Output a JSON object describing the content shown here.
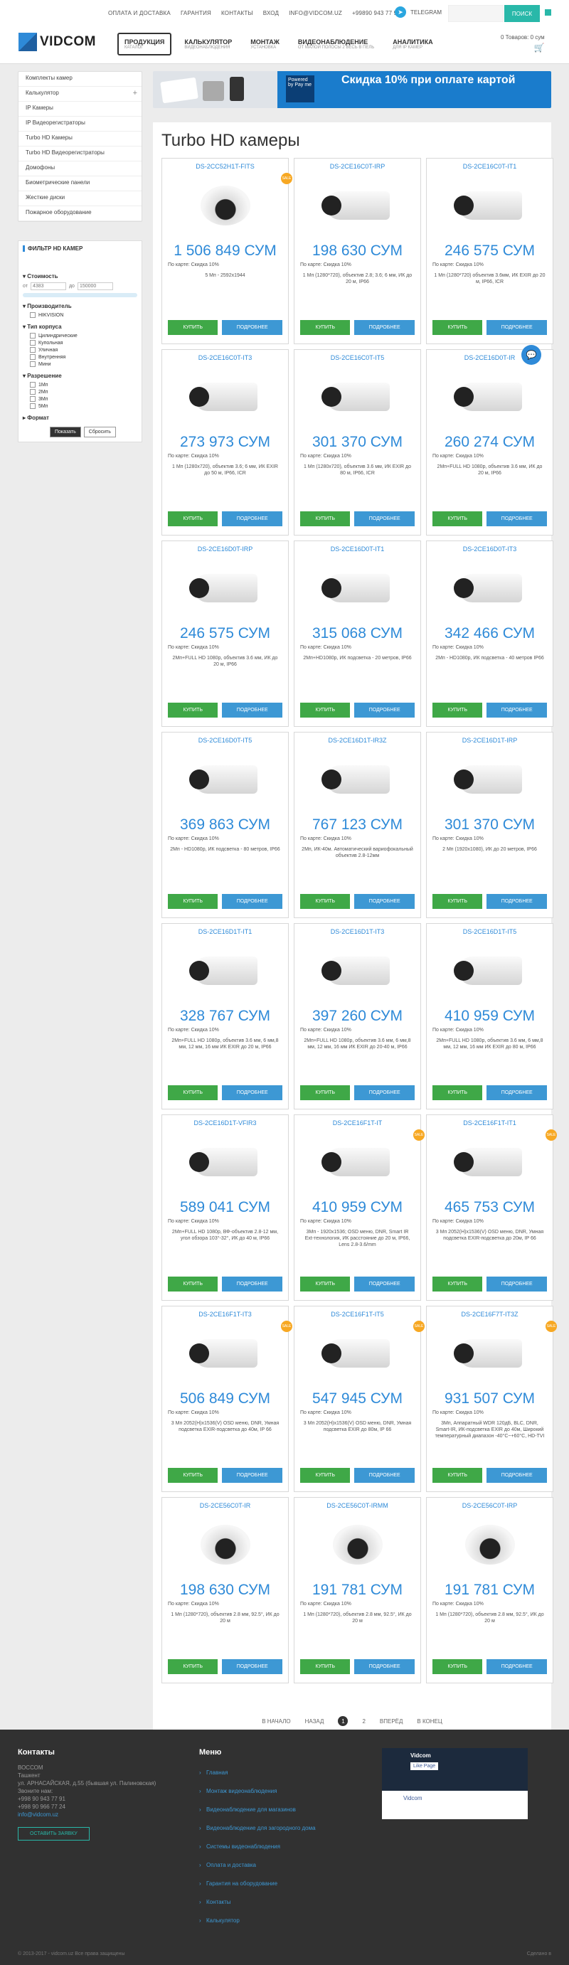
{
  "topbar": {
    "links": [
      "ОПЛАТА И ДОСТАВКА",
      "ГАРАНТИЯ",
      "КОНТАКТЫ",
      "ВХОД",
      "INFO@VIDCOM.UZ",
      "+99890 943 77 91"
    ],
    "telegram": "TELEGRAM",
    "search_button": "ПОИСК"
  },
  "header": {
    "logo": "VIDCOM",
    "nav": [
      {
        "title": "ПРОДУКЦИЯ",
        "sub": "КАТАЛОГ"
      },
      {
        "title": "КАЛЬКУЛЯТОР",
        "sub": "ВИДЕОНАБЛЮДЕНИЯ"
      },
      {
        "title": "МОНТАЖ",
        "sub": "УСТАНОВКА"
      },
      {
        "title": "ВИДЕОНАБЛЮДЕНИЕ",
        "sub": "ОТ МАЛОЙ ПОЛОСЫ 2 ВЕСЬ В ПЕЛЬ"
      },
      {
        "title": "АНАЛИТИКА",
        "sub": "ДЛЯ IP КАМЕР"
      }
    ],
    "cart": "0 Товаров: 0 сум"
  },
  "sidebar": {
    "categories": [
      "Комплекты камер",
      "Калькулятор",
      "IP Камеры",
      "IP Видеорегистраторы",
      "Turbo HD Камеры",
      "Turbo HD Видеорегистраторы",
      "Домофоны",
      "Биометрические панели",
      "Жесткие диски",
      "Пожарное оборудование"
    ],
    "filter": {
      "title": "ФИЛЬТР HD КАМЕР",
      "cost_label": "Стоимость",
      "from_label": "от",
      "from_value": "4383",
      "to_label": "до",
      "to_value": "150000",
      "maker_label": "Производитель",
      "makers": [
        "HIKVISION"
      ],
      "body_label": "Тип корпуса",
      "bodies": [
        "Цилиндрические",
        "Купольная",
        "Уличная",
        "Внутренняя",
        "Мини"
      ],
      "res_label": "Разрешение",
      "resolutions": [
        "1Мп",
        "2Мп",
        "3Мп",
        "5Мп"
      ],
      "format_label": "Формат",
      "show_button": "Показать",
      "reset_button": "Сбросить"
    }
  },
  "banner": {
    "powered": "Powered by Pay me",
    "text": "Скидка 10% при оплате картой"
  },
  "page_title": "Turbo HD камеры",
  "products": [
    {
      "code": "DS-2CC52H1T-FITS",
      "price": "1 506 849 СУМ",
      "card": "По карте:  Скидка 10%",
      "desc": "5 Мп - 2592х1944",
      "shape": "dome",
      "sale": true
    },
    {
      "code": "DS-2CE16C0T-IRP",
      "price": "198 630 СУМ",
      "card": "По карте:  Скидка 10%",
      "desc": "1 Мп (1280*720), объектив 2.8; 3.6; 6 мм, ИК до 20 м, IP66",
      "shape": "cam",
      "sale": false
    },
    {
      "code": "DS-2CE16C0T-IT1",
      "price": "246 575 СУМ",
      "card": "По карте:  Скидка 10%",
      "desc": "1 Мп (1280*720) объектив 3.6мм, ИК EXIR до 20 м, IP66, ICR",
      "shape": "cam",
      "sale": false
    },
    {
      "code": "DS-2CE16C0T-IT3",
      "price": "273 973 СУМ",
      "card": "По карте:  Скидка 10%",
      "desc": "1 Мп (1280x720), объектив 3.6; 6 мм, ИК EXIR до 50 м, IP66, ICR",
      "shape": "cam",
      "sale": false
    },
    {
      "code": "DS-2CE16C0T-IT5",
      "price": "301 370 СУМ",
      "card": "По карте:  Скидка 10%",
      "desc": "1 Мп (1280x720), объектив 3.6 мм, ИК EXIR до 80 м, IP66, ICR",
      "shape": "cam",
      "sale": false
    },
    {
      "code": "DS-2CE16D0T-IR",
      "price": "260 274 СУМ",
      "card": "По карте:  Скидка 10%",
      "desc": "2Мп+FULL HD 1080p, объектив 3.6 мм, ИК до 20 м, IP66",
      "shape": "cam",
      "sale": false
    },
    {
      "code": "DS-2CE16D0T-IRP",
      "price": "246 575 СУМ",
      "card": "По карте:  Скидка 10%",
      "desc": "2Мп+FULL HD 1080p, объектив 3.6 мм, ИК до 20 м, IP66",
      "shape": "cam",
      "sale": false
    },
    {
      "code": "DS-2CE16D0T-IT1",
      "price": "315 068 СУМ",
      "card": "По карте:  Скидка 10%",
      "desc": "2Мп+HD1080p, ИК подсветка - 20 метров, IP66",
      "shape": "cam",
      "sale": false
    },
    {
      "code": "DS-2CE16D0T-IT3",
      "price": "342 466 СУМ",
      "card": "По карте:  Скидка 10%",
      "desc": "2Мп - HD1080p, ИК подсветка - 40 метров IP66",
      "shape": "cam",
      "sale": false
    },
    {
      "code": "DS-2CE16D0T-IT5",
      "price": "369 863 СУМ",
      "card": "По карте:  Скидка 10%",
      "desc": "2Мп - HD1080p, ИК подсветка - 80 метров, IP66",
      "shape": "cam",
      "sale": false
    },
    {
      "code": "DS-2CE16D1T-IR3Z",
      "price": "767 123 СУМ",
      "card": "По карте:  Скидка 10%",
      "desc": "2Мп, ИК-40м. Автоматический вариофокальный объектив 2.8-12мм",
      "shape": "cam",
      "sale": false
    },
    {
      "code": "DS-2CE16D1T-IRP",
      "price": "301 370 СУМ",
      "card": "По карте:  Скидка 10%",
      "desc": "2 Мп (1920x1080), ИК до 20 метров, IP66",
      "shape": "cam",
      "sale": false
    },
    {
      "code": "DS-2CE16D1T-IT1",
      "price": "328 767 СУМ",
      "card": "По карте:  Скидка 10%",
      "desc": "2Мп+FULL HD 1080p, объектив 3.6 мм, 6 мм,8 мм, 12 мм, 16 мм ИК EXIR до 20 м, IP66",
      "shape": "cam",
      "sale": false
    },
    {
      "code": "DS-2CE16D1T-IT3",
      "price": "397 260 СУМ",
      "card": "По карте:  Скидка 10%",
      "desc": "2Мп+FULL HD 1080p, объектив 3.6 мм, 6 мм,8 мм, 12 мм, 16 мм ИК EXIR до 20-40 м, IP66",
      "shape": "cam",
      "sale": false
    },
    {
      "code": "DS-2CE16D1T-IT5",
      "price": "410 959 СУМ",
      "card": "По карте:  Скидка 10%",
      "desc": "2Мп+FULL HD 1080p, объектив 3.6 мм, 6 мм,8 мм, 12 мм, 16 мм ИК EXIR до 80 м, IP66",
      "shape": "cam",
      "sale": false
    },
    {
      "code": "DS-2CE16D1T-VFIR3",
      "price": "589 041 СУМ",
      "card": "По карте:  Скидка 10%",
      "desc": "2Мп+FULL HD 1080p, ВФ-объектив 2.8-12 мм, угол обзора 103°-32°, ИК до 40 м, IP66",
      "shape": "cam",
      "sale": false
    },
    {
      "code": "DS-2CE16F1T-IT",
      "price": "410 959 СУМ",
      "card": "По карте:  Скидка 10%",
      "desc": "3Мп - 1920x1536; OSD меню, DNR, Smart IR Ext-технология, ИК расстояние до 20 м, IP66, Lens 2.8-3.6/mm",
      "shape": "cam",
      "sale": true
    },
    {
      "code": "DS-2CE16F1T-IT1",
      "price": "465 753 СУМ",
      "card": "По карте:  Скидка 10%",
      "desc": "3 Мп 2052(H)x1536(V) OSD меню, DNR, Умная подсветка EXIR-подсветка до 20м, IP 66",
      "shape": "cam",
      "sale": true
    },
    {
      "code": "DS-2CE16F1T-IT3",
      "price": "506 849 СУМ",
      "card": "По карте:  Скидка 10%",
      "desc": "3 Мп 2052(H)x1536(V) OSD меню, DNR, Умная подсветка EXIR-подсветка до 40м, IP 66",
      "shape": "cam",
      "sale": true
    },
    {
      "code": "DS-2CE16F1T-IT5",
      "price": "547 945 СУМ",
      "card": "По карте:  Скидка 10%",
      "desc": "3 Мп 2052(H)x1536(V) OSD меню, DNR, Умная подсветка EXIR до 80м, IP 66",
      "shape": "cam",
      "sale": true
    },
    {
      "code": "DS-2CE16F7T-IT3Z",
      "price": "931 507 СУМ",
      "card": "По карте:  Скидка 10%",
      "desc": "3Мп, Аппаратный WDR 120дБ, BLC, DNR, Smart-IR, ИК-подсветка EXIR до 40м, Широкий температурный диапазон -40°C~+60°C, HD-TVI выход, IP66",
      "shape": "cam",
      "sale": true
    },
    {
      "code": "DS-2CE56C0T-IR",
      "price": "198 630 СУМ",
      "card": "По карте:  Скидка 10%",
      "desc": "1 Мп (1280*720), объектив 2.8 мм, 92.5°, ИК до 20 м",
      "shape": "dome",
      "sale": false
    },
    {
      "code": "DS-2CE56C0T-IRMM",
      "price": "191 781 СУМ",
      "card": "По карте:  Скидка 10%",
      "desc": "1 Мп (1280*720), объектив 2.8 мм, 92.5°, ИК до 20 м",
      "shape": "dome",
      "sale": false
    },
    {
      "code": "DS-2CE56C0T-IRP",
      "price": "191 781 СУМ",
      "card": "По карте:  Скидка 10%",
      "desc": "1 Мп (1280*720), объектив 2.8 мм, 92.5°, ИК до 20 м",
      "shape": "dome",
      "sale": false
    }
  ],
  "product_buttons": {
    "buy": "КУПИТЬ",
    "more": "ПОДРОБНЕЕ"
  },
  "pager": {
    "first": "В НАЧАЛО",
    "prev": "НАЗАД",
    "current": "1",
    "next_page": "2",
    "next": "ВПЕРЁД",
    "last": "В КОНЕЦ"
  },
  "footer": {
    "contacts_title": "Контакты",
    "contacts": [
      "ВОССОМ",
      "Ташкент",
      "ул. АРНАСАЙСКАЯ, д.55 (бывшая ул. Палиновская)",
      "Звоните нам:",
      "+998 90 943 77 91",
      "+998 90 966 77 24"
    ],
    "email": "info@vidcom.uz",
    "order_button": "ОСТАВИТЬ ЗАЯВКУ",
    "menu_title": "Меню",
    "menu": [
      "Главная",
      "Монтаж видеонаблюдения",
      "Видеонаблюдение для магазинов",
      "Видеонаблюдение для загородного дома",
      "Системы видеонаблюдения",
      "Оплата и доставка",
      "Гарантия на оборудование",
      "Контакты",
      "Калькулятор"
    ],
    "fb_name": "Vidcom",
    "fb_like": "Like Page",
    "fb_post_name": "Vidcom",
    "copyright": "© 2013-2017 - vidcom.uz Все права защищены",
    "dev": "Сделано в"
  },
  "colors": {
    "accent": "#2e8ad8",
    "teal": "#29b8a9",
    "green": "#3fa847",
    "footer": "#313131"
  }
}
